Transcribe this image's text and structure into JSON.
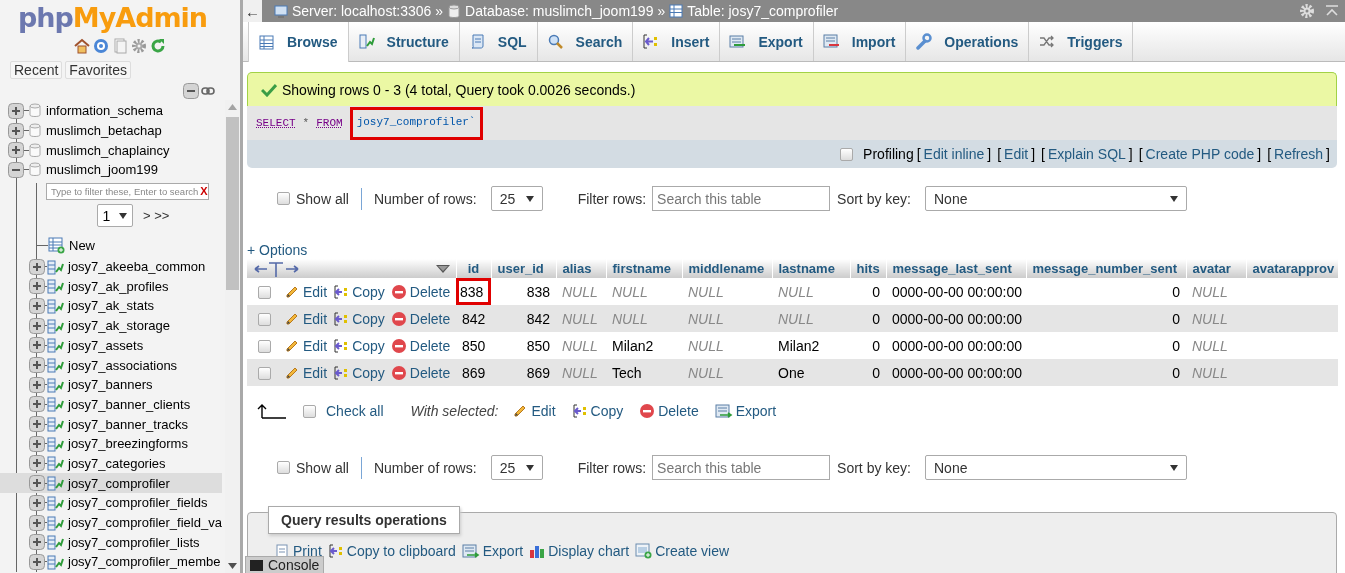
{
  "sidebar": {
    "logo": {
      "part_1": "php",
      "part_2": "MyAdmin"
    },
    "tabs": [
      {
        "label": "Recent"
      },
      {
        "label": "Favorites"
      }
    ],
    "databases": [
      {
        "name": "information_schema",
        "expanded": false
      },
      {
        "name": "muslimch_betachap",
        "expanded": false
      },
      {
        "name": "muslimch_chaplaincy",
        "expanded": false
      },
      {
        "name": "muslimch_joom199",
        "expanded": true,
        "filter_placeholder": "Type to filter these, Enter to search",
        "filter_clear": "X",
        "page": "1",
        "page_next": "> >>",
        "new_label": "New",
        "tables": [
          {
            "name": "josy7_akeeba_common",
            "selected": false
          },
          {
            "name": "josy7_ak_profiles",
            "selected": false
          },
          {
            "name": "josy7_ak_stats",
            "selected": false
          },
          {
            "name": "josy7_ak_storage",
            "selected": false
          },
          {
            "name": "josy7_assets",
            "selected": false
          },
          {
            "name": "josy7_associations",
            "selected": false
          },
          {
            "name": "josy7_banners",
            "selected": false
          },
          {
            "name": "josy7_banner_clients",
            "selected": false
          },
          {
            "name": "josy7_banner_tracks",
            "selected": false
          },
          {
            "name": "josy7_breezingforms",
            "selected": false
          },
          {
            "name": "josy7_categories",
            "selected": false
          },
          {
            "name": "josy7_comprofiler",
            "selected": true
          },
          {
            "name": "josy7_comprofiler_fields",
            "selected": false
          },
          {
            "name": "josy7_comprofiler_field_va",
            "selected": false
          },
          {
            "name": "josy7_comprofiler_lists",
            "selected": false
          },
          {
            "name": "josy7_comprofiler_membe",
            "selected": false
          }
        ]
      }
    ]
  },
  "back": "←",
  "breadcrumb": [
    {
      "kind": "server",
      "label": "Server: localhost:3306",
      "separator": "»"
    },
    {
      "kind": "database",
      "label": "Database: muslimch_joom199",
      "separator": "»"
    },
    {
      "kind": "table",
      "label": "Table: josy7_comprofiler"
    }
  ],
  "tabs": [
    {
      "kind": "browse",
      "label": "Browse",
      "selected": true
    },
    {
      "kind": "structure",
      "label": "Structure",
      "selected": false
    },
    {
      "kind": "sql",
      "label": "SQL",
      "selected": false
    },
    {
      "kind": "search",
      "label": "Search",
      "selected": false
    },
    {
      "kind": "insert",
      "label": "Insert",
      "selected": false
    },
    {
      "kind": "export",
      "label": "Export",
      "selected": false
    },
    {
      "kind": "import",
      "label": "Import",
      "selected": false
    },
    {
      "kind": "operations",
      "label": "Operations",
      "selected": false
    },
    {
      "kind": "triggers",
      "label": "Triggers",
      "selected": false
    }
  ],
  "message": "Showing rows 0 - 3 (4 total, Query took 0.0026 seconds.)",
  "query": {
    "tokens": [
      {
        "kind": "keyword",
        "text": "SELECT",
        "highlighted": false
      },
      {
        "kind": "operator",
        "text": "*",
        "highlighted": false
      },
      {
        "kind": "keyword",
        "text": "FROM",
        "highlighted": false
      },
      {
        "kind": "identifier",
        "text": "josy7_comprofiler`",
        "highlighted": true
      }
    ]
  },
  "profiling": {
    "label": "Profiling",
    "checked": false,
    "bracket_open": "[",
    "bracket_close": "]",
    "links": [
      "Edit inline",
      "Edit",
      "Explain SQL",
      "Create PHP code",
      "Refresh"
    ]
  },
  "navigation": [
    {
      "show_all": "Show all",
      "show_all_checked": false,
      "rows_label": "Number of rows:",
      "rows_value": "25",
      "filter_label": "Filter rows:",
      "filter_placeholder": "Search this table",
      "sort_label": "Sort by key:",
      "sort_value": "None"
    },
    {
      "show_all": "Show all",
      "show_all_checked": false,
      "rows_label": "Number of rows:",
      "rows_value": "25",
      "filter_label": "Filter rows:",
      "filter_placeholder": "Search this table",
      "sort_label": "Sort by key:",
      "sort_value": "None"
    }
  ],
  "options": "+ Options",
  "table": {
    "columns": [
      {
        "label": "id"
      },
      {
        "label": "user_id"
      },
      {
        "label": "alias"
      },
      {
        "label": "firstname"
      },
      {
        "label": "middlename"
      },
      {
        "label": "lastname"
      },
      {
        "label": "hits"
      },
      {
        "label": "message_last_sent"
      },
      {
        "label": "message_number_sent"
      },
      {
        "label": "avatar"
      },
      {
        "label": "avatarapprov"
      }
    ],
    "rows": [
      {
        "checked": false,
        "actions": [
          "Edit",
          "Copy",
          "Delete"
        ],
        "cells": [
          {
            "value": "838",
            "null": false,
            "highlighted": true
          },
          {
            "value": "838",
            "null": false
          },
          {
            "value": "NULL",
            "null": true
          },
          {
            "value": "NULL",
            "null": true
          },
          {
            "value": "NULL",
            "null": true
          },
          {
            "value": "NULL",
            "null": true
          },
          {
            "value": "0",
            "null": false
          },
          {
            "value": "0000-00-00 00:00:00",
            "null": false
          },
          {
            "value": "0",
            "null": false
          },
          {
            "value": "NULL",
            "null": true
          }
        ]
      },
      {
        "checked": false,
        "actions": [
          "Edit",
          "Copy",
          "Delete"
        ],
        "cells": [
          {
            "value": "842",
            "null": false,
            "highlighted": false
          },
          {
            "value": "842",
            "null": false
          },
          {
            "value": "NULL",
            "null": true
          },
          {
            "value": "NULL",
            "null": true
          },
          {
            "value": "NULL",
            "null": true
          },
          {
            "value": "NULL",
            "null": true
          },
          {
            "value": "0",
            "null": false
          },
          {
            "value": "0000-00-00 00:00:00",
            "null": false
          },
          {
            "value": "0",
            "null": false
          },
          {
            "value": "NULL",
            "null": true
          }
        ]
      },
      {
        "checked": false,
        "actions": [
          "Edit",
          "Copy",
          "Delete"
        ],
        "cells": [
          {
            "value": "850",
            "null": false,
            "highlighted": false
          },
          {
            "value": "850",
            "null": false
          },
          {
            "value": "NULL",
            "null": true
          },
          {
            "value": "Milan2",
            "null": false
          },
          {
            "value": "NULL",
            "null": true
          },
          {
            "value": "Milan2",
            "null": false
          },
          {
            "value": "0",
            "null": false
          },
          {
            "value": "0000-00-00 00:00:00",
            "null": false
          },
          {
            "value": "0",
            "null": false
          },
          {
            "value": "NULL",
            "null": true
          }
        ]
      },
      {
        "checked": false,
        "actions": [
          "Edit",
          "Copy",
          "Delete"
        ],
        "cells": [
          {
            "value": "869",
            "null": false,
            "highlighted": false
          },
          {
            "value": "869",
            "null": false
          },
          {
            "value": "NULL",
            "null": true
          },
          {
            "value": "Tech",
            "null": false
          },
          {
            "value": "NULL",
            "null": true
          },
          {
            "value": "One",
            "null": false
          },
          {
            "value": "0",
            "null": false
          },
          {
            "value": "0000-00-00 00:00:00",
            "null": false
          },
          {
            "value": "0",
            "null": false
          },
          {
            "value": "NULL",
            "null": true
          }
        ]
      }
    ]
  },
  "bulk": {
    "check_all": "Check all",
    "check_all_checked": false,
    "with_selected": "With selected:",
    "actions": [
      {
        "kind": "edit",
        "label": "Edit"
      },
      {
        "kind": "copy",
        "label": "Copy"
      },
      {
        "kind": "delete",
        "label": "Delete"
      },
      {
        "kind": "export",
        "label": "Export"
      }
    ]
  },
  "operations": {
    "legend": "Query results operations",
    "actions": [
      {
        "kind": "print",
        "label": "Print"
      },
      {
        "kind": "copy",
        "label": "Copy to clipboard"
      },
      {
        "kind": "export",
        "label": "Export"
      },
      {
        "kind": "chart",
        "label": "Display chart"
      },
      {
        "kind": "view",
        "label": "Create view"
      }
    ]
  },
  "console": "Console"
}
